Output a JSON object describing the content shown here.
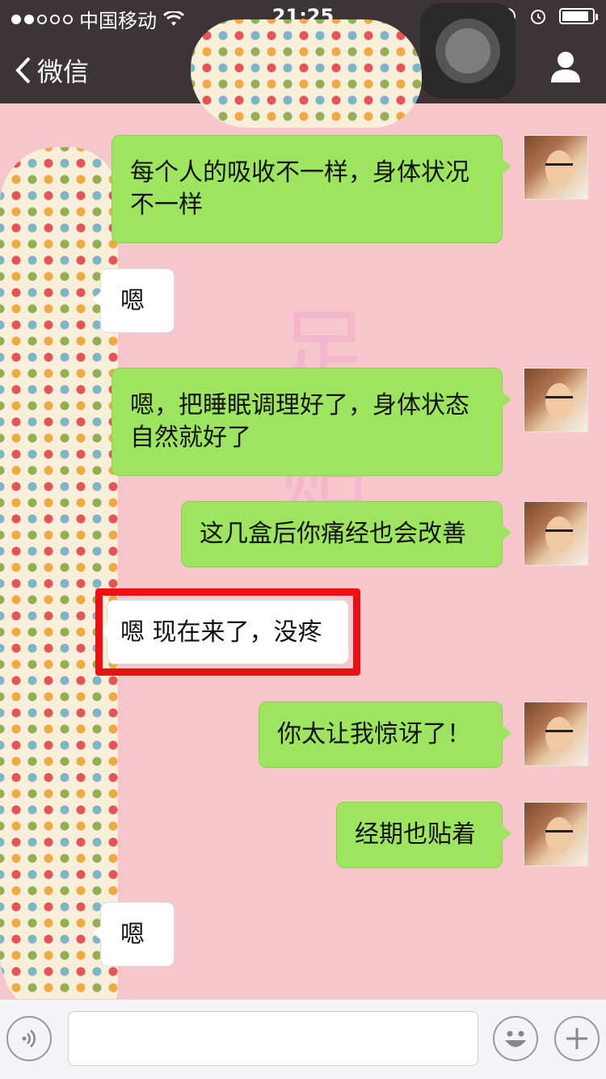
{
  "status_bar": {
    "carrier": "中国移动",
    "time": "21:25",
    "signal_dots_filled": 2,
    "signal_dots_total": 5,
    "battery_level": 0.9
  },
  "nav": {
    "back_label": "微信",
    "right_icon": "profile-icon"
  },
  "watermark_text": "足贴",
  "messages": [
    {
      "side": "out",
      "text": "每个人的吸收不一样，身体状况不一样"
    },
    {
      "side": "in",
      "text": "嗯"
    },
    {
      "side": "out",
      "text": "嗯，把睡眠调理好了，身体状态自然就好了"
    },
    {
      "side": "out",
      "text": "这几盒后你痛经也会改善"
    },
    {
      "side": "in",
      "text": "嗯 现在来了，没疼",
      "highlighted": true
    },
    {
      "side": "out",
      "text": "你太让我惊讶了！"
    },
    {
      "side": "out",
      "text": "经期也贴着"
    },
    {
      "side": "in",
      "text": "嗯"
    }
  ],
  "input_bar": {
    "voice_icon": "voice-icon",
    "emoji_icon": "emoji-icon",
    "plus_icon": "plus-icon",
    "placeholder": ""
  },
  "colors": {
    "outgoing_bubble": "#9de55e",
    "incoming_bubble": "#ffffff",
    "highlight_border": "#ee0f12",
    "chat_background": "#f6c6cc",
    "nav_background": "#3c3436"
  }
}
